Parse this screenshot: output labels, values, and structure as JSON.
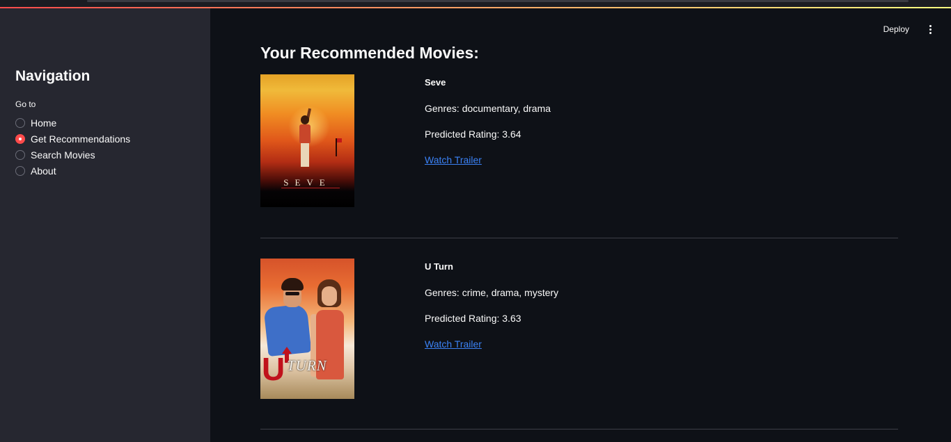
{
  "sidebar": {
    "title": "Navigation",
    "goto_label": "Go to",
    "options": [
      {
        "label": "Home",
        "selected": false
      },
      {
        "label": "Get Recommendations",
        "selected": true
      },
      {
        "label": "Search Movies",
        "selected": false
      },
      {
        "label": "About",
        "selected": false
      }
    ]
  },
  "header": {
    "deploy_label": "Deploy",
    "menu_icon": "vertical-ellipsis-icon"
  },
  "main": {
    "title": "Your Recommended Movies:",
    "movies": [
      {
        "title": "Seve",
        "genres": "Genres: documentary, drama",
        "rating": "Predicted Rating: 3.64",
        "trailer_label": "Watch Trailer",
        "poster_text": "SEVE"
      },
      {
        "title": "U Turn",
        "genres": "Genres: crime, drama, mystery",
        "rating": "Predicted Rating: 3.63",
        "trailer_label": "Watch Trailer",
        "poster_text_first": "U",
        "poster_text_rest": "TURN"
      }
    ]
  },
  "colors": {
    "accent": "#ff4b4b",
    "link": "#3b82f6",
    "background": "#0e1117",
    "sidebar_background": "#262730"
  }
}
